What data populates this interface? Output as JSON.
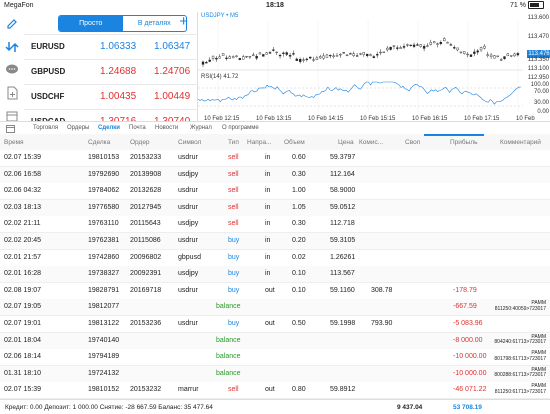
{
  "status": {
    "carrier": "MegaFon",
    "time": "18:18",
    "battery": "71 %",
    "battery_level": 0.71
  },
  "quotes": {
    "mode_simple": "Просто",
    "mode_detail": "В деталях",
    "rows": [
      {
        "symbol": "EURUSD",
        "bid": "1.06333",
        "ask": "1.06347",
        "color": "#1a84e0"
      },
      {
        "symbol": "GBPUSD",
        "bid": "1.24688",
        "ask": "1.24706",
        "color": "#e03030"
      },
      {
        "symbol": "USDCHF",
        "bid": "1.00435",
        "ask": "1.00449",
        "color": "#e03030"
      },
      {
        "symbol": "USDCAD",
        "bid": "1.30716",
        "ask": "1.30740",
        "color": "#e03030"
      }
    ]
  },
  "chart": {
    "title": "USDJPY • M5",
    "rsi_title": "RSI(14) 41.72",
    "price_labels": [
      "113.600",
      "113.470",
      "113.350",
      "113.100",
      "112.950"
    ],
    "price_box": "113.476",
    "rsi_labels": [
      "100.00",
      "70.00",
      "30.00",
      "0.00"
    ],
    "time_labels": [
      "10 Feb 12:15",
      "10 Feb 13:15",
      "10 Feb 14:15",
      "10 Feb 15:15",
      "10 Feb 16:15",
      "10 Feb 17:15",
      "10 Feb 18:15"
    ]
  },
  "tabs": [
    "Торговля",
    "Ордеры",
    "Сделки",
    "Почта",
    "Новости",
    "Журнал",
    "О программе"
  ],
  "active_tab": 2,
  "table": {
    "headers": [
      "Время",
      "Сделка",
      "Ордер",
      "Символ",
      "Тип",
      "Напра...",
      "Объем",
      "Цена",
      "Комис...",
      "Своп",
      "Прибыль",
      "Комментарий"
    ],
    "rows": [
      {
        "time": "02.07 15:39",
        "deal": "19810153",
        "order": "20153233",
        "symbol": "usdrur",
        "type": "sell",
        "dir": "in",
        "vol": "0.60",
        "price": "59.3797",
        "swap": "",
        "profit": "",
        "comment": ""
      },
      {
        "time": "02.06 16:58",
        "deal": "19792690",
        "order": "20139908",
        "symbol": "usdjpy",
        "type": "sell",
        "dir": "in",
        "vol": "0.30",
        "price": "112.164",
        "swap": "",
        "profit": "",
        "comment": ""
      },
      {
        "time": "02.06 04:32",
        "deal": "19784062",
        "order": "20132628",
        "symbol": "usdrur",
        "type": "sell",
        "dir": "in",
        "vol": "1.00",
        "price": "58.9000",
        "swap": "",
        "profit": "",
        "comment": ""
      },
      {
        "time": "02.03 18:13",
        "deal": "19776580",
        "order": "20127945",
        "symbol": "usdrur",
        "type": "sell",
        "dir": "in",
        "vol": "1.05",
        "price": "59.0512",
        "swap": "",
        "profit": "",
        "comment": ""
      },
      {
        "time": "02.02 21:11",
        "deal": "19763110",
        "order": "20115643",
        "symbol": "usdjpy",
        "type": "sell",
        "dir": "in",
        "vol": "0.30",
        "price": "112.718",
        "swap": "",
        "profit": "",
        "comment": ""
      },
      {
        "time": "02.02 20:45",
        "deal": "19762381",
        "order": "20115086",
        "symbol": "usdrur",
        "type": "buy",
        "dir": "in",
        "vol": "0.20",
        "price": "59.3105",
        "swap": "",
        "profit": "",
        "comment": ""
      },
      {
        "time": "02.01 21:57",
        "deal": "19742860",
        "order": "20096802",
        "symbol": "gbpusd",
        "type": "buy",
        "dir": "in",
        "vol": "0.02",
        "price": "1.26261",
        "swap": "",
        "profit": "",
        "comment": ""
      },
      {
        "time": "02.01 16:28",
        "deal": "19738327",
        "order": "20092391",
        "symbol": "usdjpy",
        "type": "buy",
        "dir": "in",
        "vol": "0.10",
        "price": "113.567",
        "swap": "",
        "profit": "",
        "comment": ""
      },
      {
        "time": "02.08 19:07",
        "deal": "19828791",
        "order": "20169718",
        "symbol": "usdrur",
        "type": "buy",
        "dir": "out",
        "vol": "0.10",
        "price": "59.1160",
        "swap": "308.78",
        "profit": "-178.79",
        "comment": ""
      },
      {
        "time": "02.07 19:05",
        "deal": "19812077",
        "order": "",
        "symbol": "",
        "type": "balance",
        "dir": "",
        "vol": "",
        "price": "",
        "swap": "",
        "profit": "-667.59",
        "comment": "PAMM\n811250:40059>723017"
      },
      {
        "time": "02.07 19:01",
        "deal": "19813122",
        "order": "20153236",
        "symbol": "usdrur",
        "type": "buy",
        "dir": "out",
        "vol": "0.50",
        "price": "59.1998",
        "swap": "793.90",
        "profit": "-5 083.96",
        "comment": ""
      },
      {
        "time": "02.01 18:04",
        "deal": "19740140",
        "order": "",
        "symbol": "",
        "type": "balance",
        "dir": "",
        "vol": "",
        "price": "",
        "swap": "",
        "profit": "-8 000.00",
        "comment": "PAMM\n804240:61713>723017"
      },
      {
        "time": "02.06 18:14",
        "deal": "19794189",
        "order": "",
        "symbol": "",
        "type": "balance",
        "dir": "",
        "vol": "",
        "price": "",
        "swap": "",
        "profit": "-10 000.00",
        "comment": "PAMM\n801798:61713>723017"
      },
      {
        "time": "01.31 18:10",
        "deal": "19724132",
        "order": "",
        "symbol": "",
        "type": "balance",
        "dir": "",
        "vol": "",
        "price": "",
        "swap": "",
        "profit": "-10 000.00",
        "comment": "PAMM\n800288:61713>723017"
      },
      {
        "time": "02.07 15:39",
        "deal": "19810152",
        "order": "20153232",
        "symbol": "marrur",
        "type": "sell",
        "dir": "out",
        "vol": "0.80",
        "price": "59.8912",
        "swap": "",
        "profit": "-46 071.22",
        "comment": "PAMM\n811250:61713>723017"
      }
    ]
  },
  "footer": {
    "summary": "Кредит: 0.00 Депозит: 1 000.00 Снятие: -28 667.59 Баланс: 35 477.64",
    "swap_total": "9 437.04",
    "profit_total": "53 708.19"
  }
}
